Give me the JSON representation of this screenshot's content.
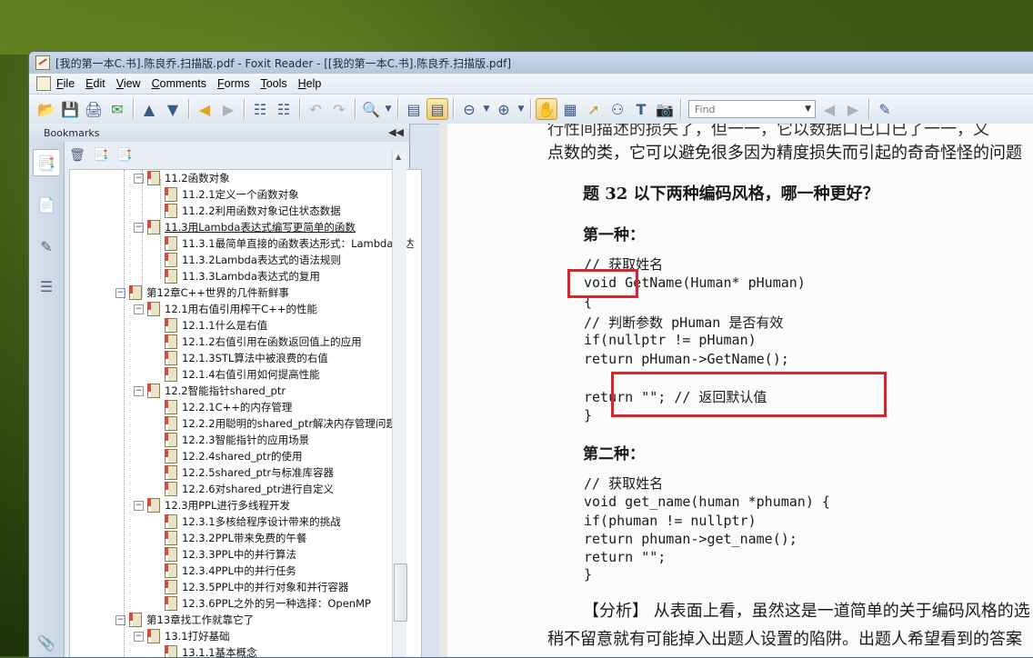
{
  "window": {
    "title": "[我的第一本C.书].陈良乔.扫描版.pdf - Foxit Reader - [[我的第一本C.书].陈良乔.扫描版.pdf]"
  },
  "menu": [
    "File",
    "Edit",
    "View",
    "Comments",
    "Forms",
    "Tools",
    "Help"
  ],
  "toolbar": {
    "find_placeholder": "Find"
  },
  "bookmarks_panel": {
    "title": "Bookmarks",
    "items": [
      {
        "label": "11.2函数对象",
        "level": 1,
        "expanded": true
      },
      {
        "label": "11.2.1定义一个函数对象",
        "level": 2
      },
      {
        "label": "11.2.2利用函数对象记住状态数据",
        "level": 2
      },
      {
        "label": "11.3用Lambda表达式编写更简单的函数",
        "level": 1,
        "expanded": true,
        "selected": true
      },
      {
        "label": "11.3.1最简单直接的函数表达形式：Lambda表达",
        "level": 2
      },
      {
        "label": "11.3.2Lambda表达式的语法规则",
        "level": 2
      },
      {
        "label": "11.3.3Lambda表达式的复用",
        "level": 2
      },
      {
        "label": "第12章C++世界的几件新鲜事",
        "level": 0,
        "expanded": true
      },
      {
        "label": "12.1用右值引用榨干C++的性能",
        "level": 1,
        "expanded": true
      },
      {
        "label": "12.1.1什么是右值",
        "level": 2
      },
      {
        "label": "12.1.2右值引用在函数返回值上的应用",
        "level": 2
      },
      {
        "label": "12.1.3STL算法中被浪费的右值",
        "level": 2
      },
      {
        "label": "12.1.4右值引用如何提高性能",
        "level": 2
      },
      {
        "label": "12.2智能指针shared_ptr",
        "level": 1,
        "expanded": true
      },
      {
        "label": "12.2.1C++的内存管理",
        "level": 2
      },
      {
        "label": "12.2.2用聪明的shared_ptr解决内存管理问题",
        "level": 2
      },
      {
        "label": "12.2.3智能指针的应用场景",
        "level": 2
      },
      {
        "label": "12.2.4shared_ptr的使用",
        "level": 2
      },
      {
        "label": "12.2.5shared_ptr与标准库容器",
        "level": 2
      },
      {
        "label": "12.2.6对shared_ptr进行自定义",
        "level": 2
      },
      {
        "label": "12.3用PPL进行多线程开发",
        "level": 1,
        "expanded": true
      },
      {
        "label": "12.3.1多核给程序设计带来的挑战",
        "level": 2
      },
      {
        "label": "12.3.2PPL带来免费的午餐",
        "level": 2
      },
      {
        "label": "12.3.3PPL中的并行算法",
        "level": 2
      },
      {
        "label": "12.3.4PPL中的并行任务",
        "level": 2
      },
      {
        "label": "12.3.5PPL中的并行对象和并行容器",
        "level": 2
      },
      {
        "label": "12.3.6PPL之外的另一种选择：OpenMP",
        "level": 2
      },
      {
        "label": "第13章找工作就靠它了",
        "level": 0,
        "expanded": true
      },
      {
        "label": "13.1打好基础",
        "level": 1,
        "expanded": true
      },
      {
        "label": "13.1.1基本概念",
        "level": 2
      }
    ]
  },
  "page": {
    "line_top1": "行性间描述的损失了，但一一，它以数据口已口已了一一，又",
    "line_top2": "点数的类，它可以避免很多因为精度损失而引起的奇奇怪怪的问题",
    "question": "题 32   以下两种编码风格，哪一种更好？",
    "style1_heading": "第一种：",
    "code1": [
      "// 获取姓名",
      "void GetName(Human* pHuman)",
      "{",
      "    // 判断参数 pHuman 是否有效",
      "    if(nullptr != pHuman)",
      "       return pHuman->GetName();",
      "",
      "    return \"\";    // 返回默认值",
      "}"
    ],
    "style2_heading": "第二种：",
    "code2": [
      "// 获取姓名",
      "void get_name(human *phuman) {",
      "     if(phuman != nullptr)",
      "          return phuman->get_name();",
      "     return \"\";",
      "}"
    ],
    "analysis1": "【分析】  从表面上看，虽然这是一道简单的关于编码风格的选",
    "analysis2": "稍不留意就有可能掉入出题人设置的陷阱。出题人希望看到的答案"
  }
}
